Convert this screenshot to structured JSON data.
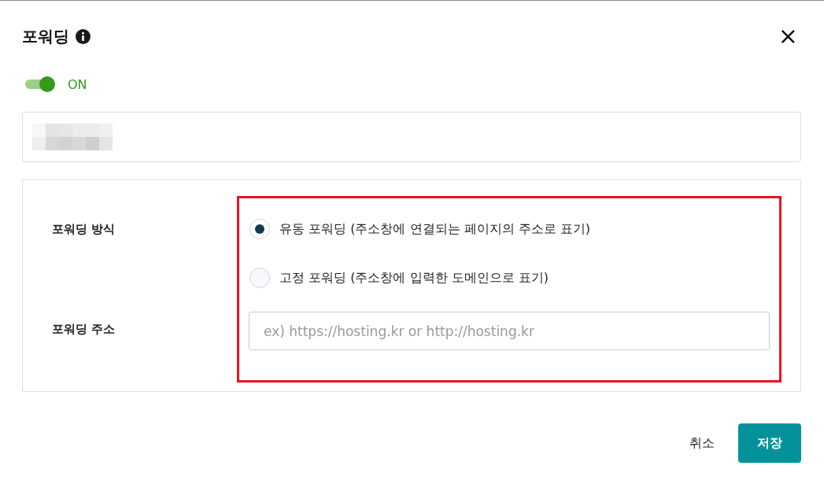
{
  "dialog": {
    "title": "포워딩",
    "close": "×"
  },
  "toggle": {
    "on": true,
    "label": "ON"
  },
  "forwarding": {
    "method_label": "포워딩 방식",
    "options": [
      {
        "label": "유동 포워딩 (주소창에 연결되는 페이지의 주소로 표기)",
        "selected": true
      },
      {
        "label": "고정 포워딩 (주소창에 입력한 도메인으로 표기)",
        "selected": false
      }
    ],
    "address_label": "포워딩 주소",
    "address_placeholder": "ex) https://hosting.kr or http://hosting.kr"
  },
  "buttons": {
    "cancel": "취소",
    "save": "저장"
  }
}
